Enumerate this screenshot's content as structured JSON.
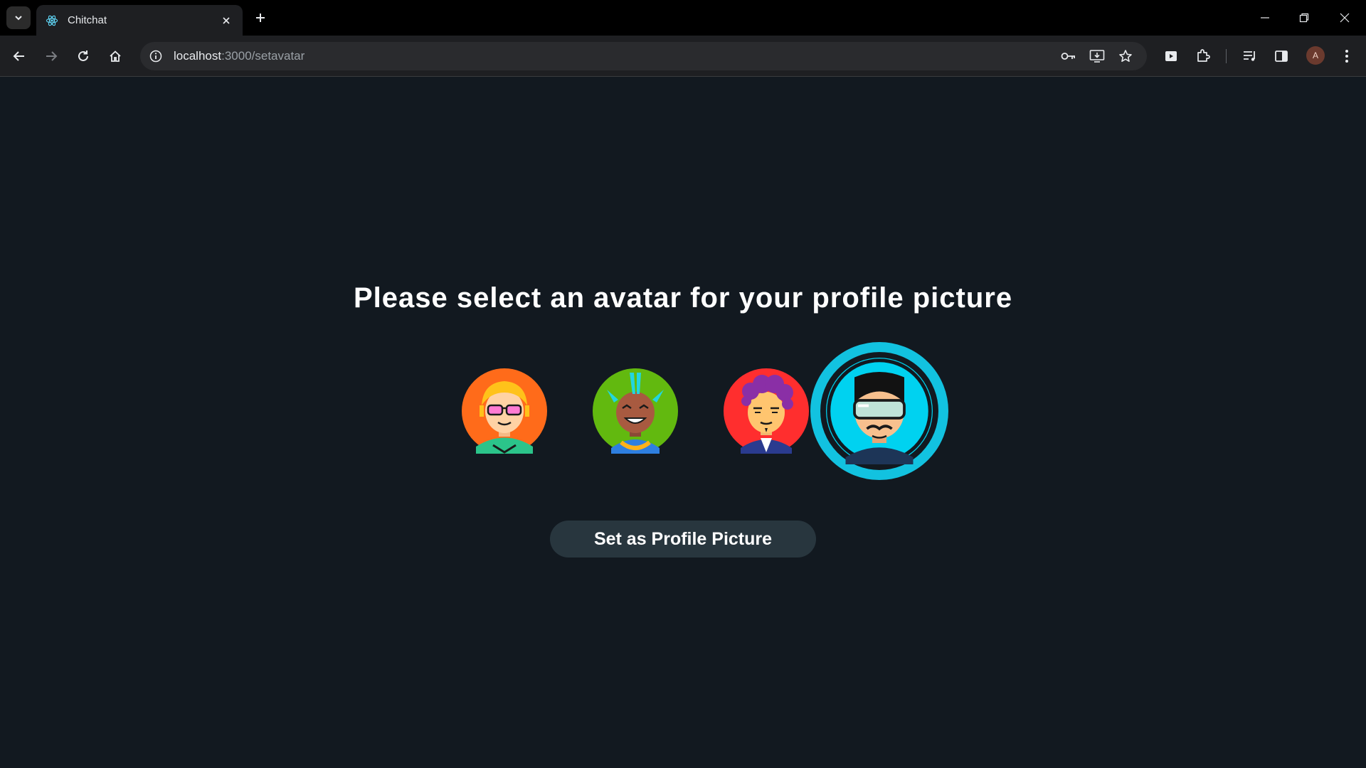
{
  "browser": {
    "tab_title": "Chitchat",
    "url_host": "localhost",
    "url_path": ":3000/setavatar",
    "profile_initial": "A"
  },
  "page": {
    "heading": "Please select an avatar for your profile picture",
    "button_label": "Set as Profile Picture",
    "selected_avatar_index": 3,
    "avatars": [
      {
        "name": "avatar-blonde-glasses",
        "bg": "#ff6b1a"
      },
      {
        "name": "avatar-mohawk-smiling",
        "bg": "#62b90f"
      },
      {
        "name": "avatar-purple-curly-hair",
        "bg": "#ff2e2e"
      },
      {
        "name": "avatar-vr-goggles-mustache",
        "bg": "#00d2f0"
      }
    ],
    "selection_ring_color": "#12c2e0",
    "button_color": "#28363e",
    "background_color": "#121920"
  }
}
